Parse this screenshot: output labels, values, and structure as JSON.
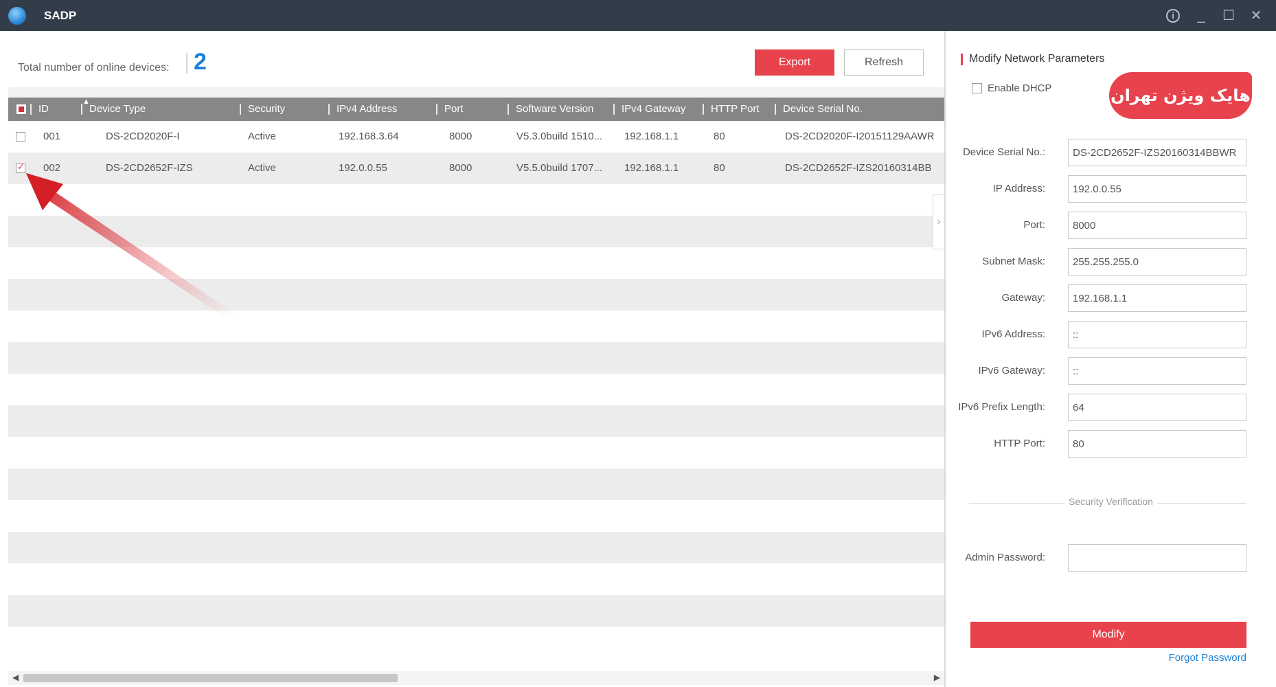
{
  "window": {
    "title": "SADP",
    "icons": [
      "app-globe-icon",
      "info-icon",
      "minimize-icon",
      "maximize-icon",
      "close-icon"
    ]
  },
  "toolbar": {
    "total_label": "Total number of online devices:",
    "total_value": "2",
    "export_label": "Export",
    "refresh_label": "Refresh"
  },
  "table": {
    "columns": [
      "ID",
      "Device Type",
      "Security",
      "IPv4 Address",
      "Port",
      "Software Version",
      "IPv4 Gateway",
      "HTTP Port",
      "Device Serial No."
    ],
    "rows": [
      {
        "checked": false,
        "id": "001",
        "device_type": "DS-2CD2020F-I",
        "security": "Active",
        "ipv4": "192.168.3.64",
        "port": "8000",
        "software": "V5.3.0build 1510...",
        "gateway": "192.168.1.1",
        "http_port": "80",
        "serial": "DS-2CD2020F-I20151129AAWR"
      },
      {
        "checked": true,
        "id": "002",
        "device_type": "DS-2CD2652F-IZS",
        "security": "Active",
        "ipv4": "192.0.0.55",
        "port": "8000",
        "software": "V5.5.0build 1707...",
        "gateway": "192.168.1.1",
        "http_port": "80",
        "serial": "DS-2CD2652F-IZS20160314BB"
      }
    ]
  },
  "panel": {
    "title": "Modify Network Parameters",
    "enable_dhcp": "Enable DHCP",
    "badge": "هایک ویژن تهران",
    "fields": [
      {
        "label": "Device Serial No.:",
        "value": "DS-2CD2652F-IZS20160314BBWR"
      },
      {
        "label": "IP Address:",
        "value": "192.0.0.55"
      },
      {
        "label": "Port:",
        "value": "8000"
      },
      {
        "label": "Subnet Mask:",
        "value": "255.255.255.0"
      },
      {
        "label": "Gateway:",
        "value": "192.168.1.1"
      },
      {
        "label": "IPv6 Address:",
        "value": "::"
      },
      {
        "label": "IPv6 Gateway:",
        "value": "::"
      },
      {
        "label": "IPv6 Prefix Length:",
        "value": "64"
      },
      {
        "label": "HTTP Port:",
        "value": "80"
      }
    ],
    "security_verification": "Security Verification",
    "admin_password_label": "Admin Password:",
    "admin_password_value": "",
    "modify_label": "Modify",
    "forgot_label": "Forgot Password"
  },
  "colors": {
    "accent": "#e8424d",
    "titlebar": "#333d4a",
    "header": "#878787",
    "link": "#1e7fd6"
  }
}
